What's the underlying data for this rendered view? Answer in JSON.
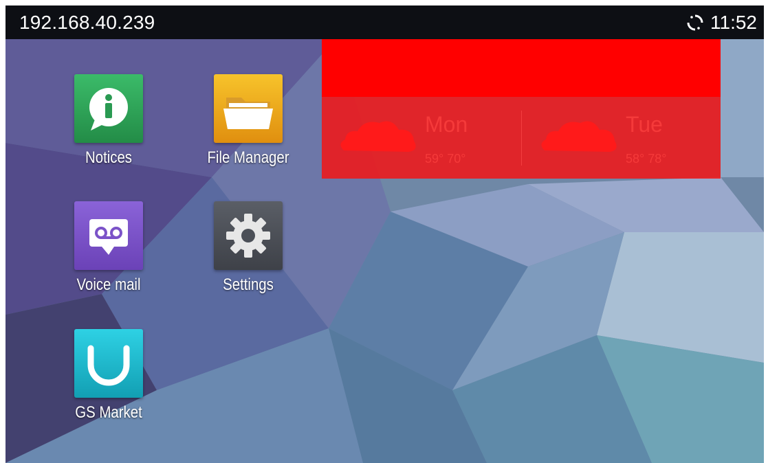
{
  "status_bar": {
    "ip_address": "192.168.40.239",
    "time": "11:52",
    "sync_icon": "sync-icon"
  },
  "apps": [
    {
      "label": "Notices",
      "icon": "info-icon",
      "color": "#2fa35a"
    },
    {
      "label": "File Manager",
      "icon": "folder-icon",
      "color": "#f0a81e"
    },
    {
      "label": "Voice mail",
      "icon": "voicemail-icon",
      "color": "#7b53c8"
    },
    {
      "label": "Settings",
      "icon": "gear-icon",
      "color": "#4b4f57"
    },
    {
      "label": "GS Market",
      "icon": "market-icon",
      "color": "#1eb3c9"
    }
  ],
  "weather": {
    "days": [
      {
        "name": "Mon",
        "temp": "59° 70°",
        "icon": "cloud-icon"
      },
      {
        "name": "Tue",
        "temp": "58° 78°",
        "icon": "cloud-icon"
      }
    ],
    "color": "#ff0000"
  }
}
